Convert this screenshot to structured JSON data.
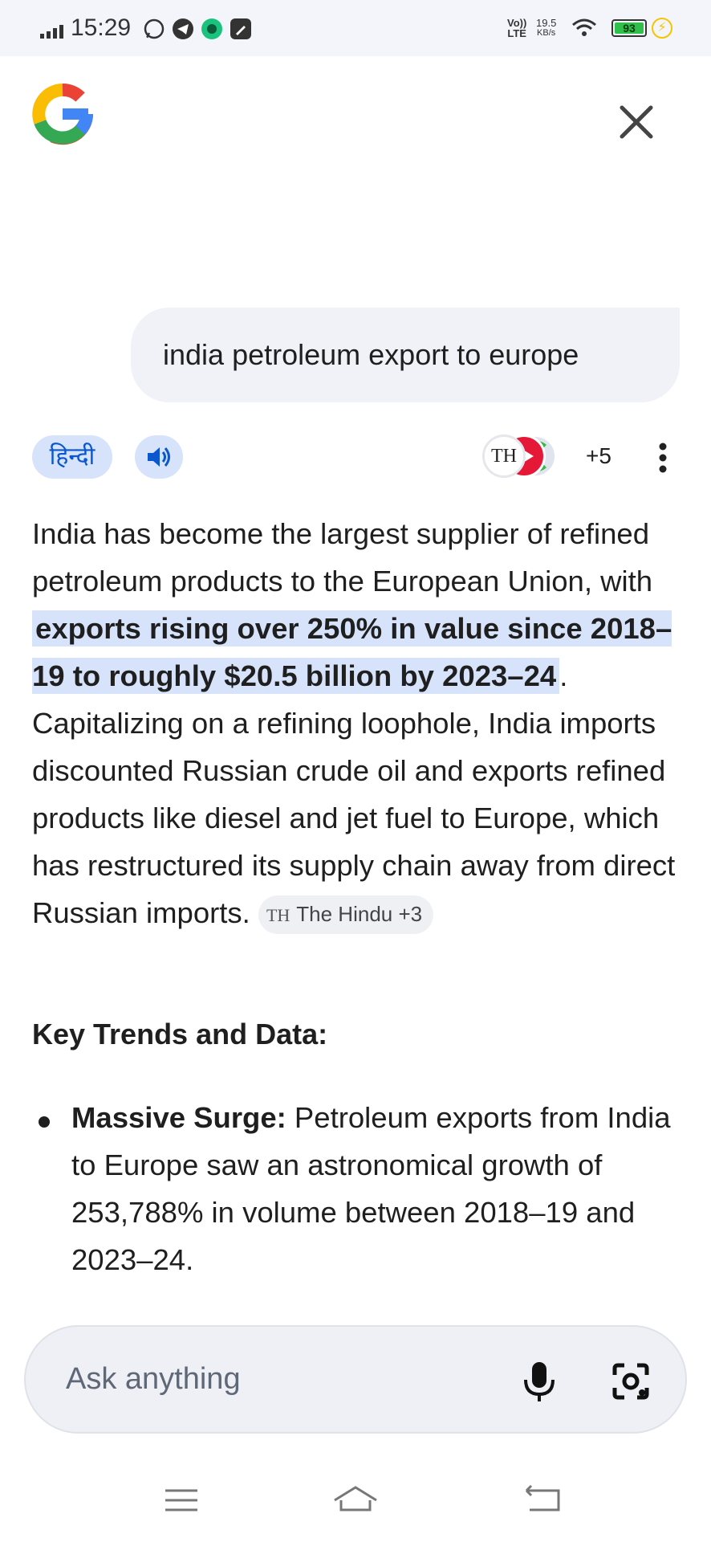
{
  "status_bar": {
    "time": "15:29",
    "net_type_top": "Vo))",
    "net_type_bottom": "LTE",
    "speed_value": "19.5",
    "speed_unit": "KB/s",
    "battery": "93"
  },
  "query": "india petroleum export to europe",
  "actions": {
    "language_label": "हिन्दी",
    "sources_more": "+5",
    "source_icon_label": "TH"
  },
  "answer": {
    "part1": "India has become the largest supplier of refined petroleum products to the European Union, with ",
    "highlight": "exports rising over 250% in value since 2018–19 to roughly $20.5 billion by 2023–24",
    "part2": ". Capitalizing on a refining loophole, India imports discounted Russian crude oil and exports refined products like diesel and jet fuel to Europe, which has restructured its supply chain away from direct Russian imports. ",
    "citation": "The Hindu +3",
    "citation_logo": "TH"
  },
  "section_title": "Key Trends and Data:",
  "bullets": [
    {
      "label": "Massive Surge:",
      "text": " Petroleum exports from India to Europe saw an astronomical growth of 253,788% in volume between 2018–19 and 2023–24."
    }
  ],
  "input": {
    "placeholder": "Ask anything"
  },
  "colors": {
    "highlight_bg": "#d6e3fb",
    "chip_text": "#0b57d0",
    "input_bg": "#eef0f5"
  }
}
